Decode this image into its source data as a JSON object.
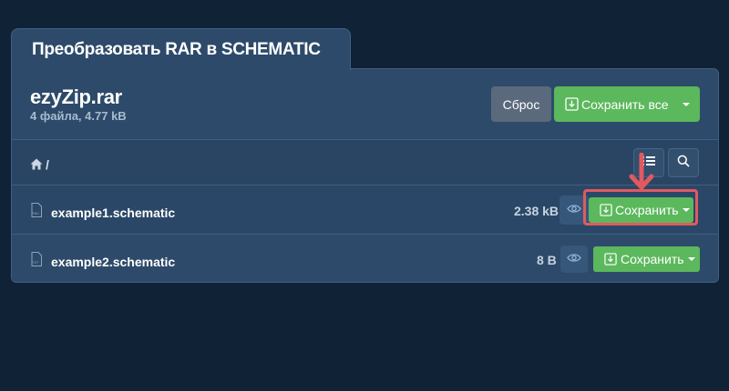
{
  "header": {
    "tab_title": "Преобразовать RAR в SCHEMATIC"
  },
  "archive": {
    "name": "ezyZip.rar",
    "meta": "4 файла, 4.77 kB",
    "reset_label": "Сброс",
    "save_all_label": "Сохранить все"
  },
  "path": {
    "separator": "/"
  },
  "files": [
    {
      "name": "example1.schematic",
      "size": "2.38 kB",
      "save_label": "Сохранить",
      "type_tag": "PNG"
    },
    {
      "name": "example2.schematic",
      "size": "8 B",
      "save_label": "Сохранить",
      "type_tag": "TXT"
    }
  ],
  "colors": {
    "background": "#102236",
    "panel": "#2d4a6a",
    "accent_green": "#5cb85c",
    "reset_gray": "#5a6a7c",
    "highlight_red": "#e05a5f"
  },
  "icons": [
    "home-icon",
    "list-icon",
    "search-icon",
    "file-icon",
    "eye-icon",
    "download-icon",
    "caret-down-icon",
    "arrow-down-icon"
  ]
}
